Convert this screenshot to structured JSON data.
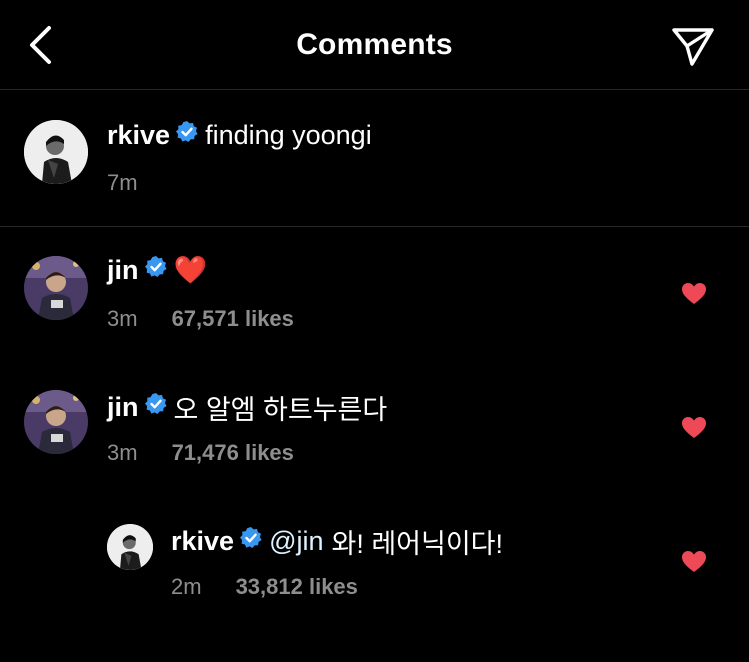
{
  "header": {
    "title": "Comments"
  },
  "caption": {
    "username": "rkive",
    "text": "finding yoongi",
    "time": "7m"
  },
  "comments": [
    {
      "username": "jin",
      "text": "❤️",
      "time": "3m",
      "likes": "67,571 likes"
    },
    {
      "username": "jin",
      "text": "오 알엠 하트누른다",
      "time": "3m",
      "likes": "71,476 likes"
    }
  ],
  "reply": {
    "username": "rkive",
    "mention": "@jin",
    "text": "와! 레어닉이다!",
    "time": "2m",
    "likes": "33,812 likes"
  },
  "colors": {
    "background": "#000000",
    "verified": "#3897f0",
    "like_heart": "#ed4956",
    "secondary_text": "#8e8e8e",
    "divider": "#262626"
  },
  "icons": {
    "back": "chevron-left-icon",
    "share": "paper-plane-icon",
    "verified": "verified-badge-icon",
    "like": "heart-icon"
  }
}
